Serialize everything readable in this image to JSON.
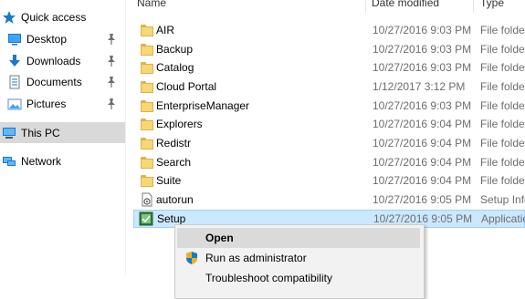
{
  "nav": {
    "items": [
      {
        "label": "Quick access",
        "icon": "star-icon"
      },
      {
        "label": "Desktop",
        "icon": "desktop-icon",
        "pinned": true
      },
      {
        "label": "Downloads",
        "icon": "download-arrow-icon",
        "pinned": true
      },
      {
        "label": "Documents",
        "icon": "documents-icon",
        "pinned": true
      },
      {
        "label": "Pictures",
        "icon": "pictures-icon",
        "pinned": true
      },
      {
        "label": "This PC",
        "icon": "computer-icon",
        "selected": true
      },
      {
        "label": "Network",
        "icon": "network-icon"
      }
    ]
  },
  "columns": {
    "name": "Name",
    "date": "Date modified",
    "type": "Type"
  },
  "files": [
    {
      "name": "AIR",
      "date": "10/27/2016 9:03 PM",
      "type": "File folder",
      "icon": "folder-icon"
    },
    {
      "name": "Backup",
      "date": "10/27/2016 9:03 PM",
      "type": "File folder",
      "icon": "folder-icon"
    },
    {
      "name": "Catalog",
      "date": "10/27/2016 9:03 PM",
      "type": "File folder",
      "icon": "folder-icon"
    },
    {
      "name": "Cloud Portal",
      "date": "1/12/2017 3:12 PM",
      "type": "File folder",
      "icon": "folder-icon"
    },
    {
      "name": "EnterpriseManager",
      "date": "10/27/2016 9:03 PM",
      "type": "File folder",
      "icon": "folder-icon"
    },
    {
      "name": "Explorers",
      "date": "10/27/2016 9:04 PM",
      "type": "File folder",
      "icon": "folder-icon"
    },
    {
      "name": "Redistr",
      "date": "10/27/2016 9:04 PM",
      "type": "File folder",
      "icon": "folder-icon"
    },
    {
      "name": "Search",
      "date": "10/27/2016 9:04 PM",
      "type": "File folder",
      "icon": "folder-icon"
    },
    {
      "name": "Suite",
      "date": "10/27/2016 9:04 PM",
      "type": "File folder",
      "icon": "folder-icon"
    },
    {
      "name": "autorun",
      "date": "10/27/2016 9:05 PM",
      "type": "Setup Info",
      "icon": "setup-info-file-icon"
    },
    {
      "name": "Setup",
      "date": "10/27/2016 9:05 PM",
      "type": "Application",
      "icon": "setup-application-icon",
      "selected": true
    }
  ],
  "context_menu": {
    "items": [
      {
        "label": "Open",
        "bold": true,
        "hover": true
      },
      {
        "label": "Run as administrator",
        "icon": "uac-shield-icon"
      },
      {
        "label": "Troubleshoot compatibility"
      }
    ]
  },
  "colors": {
    "selection_fill": "#cce8ff",
    "selection_border": "#99d1ff",
    "nav_selected": "#d9d9d9",
    "menu_background": "#f2f2f2",
    "folder_yellow": "#f8d775",
    "accent_blue": "#1979ca"
  }
}
